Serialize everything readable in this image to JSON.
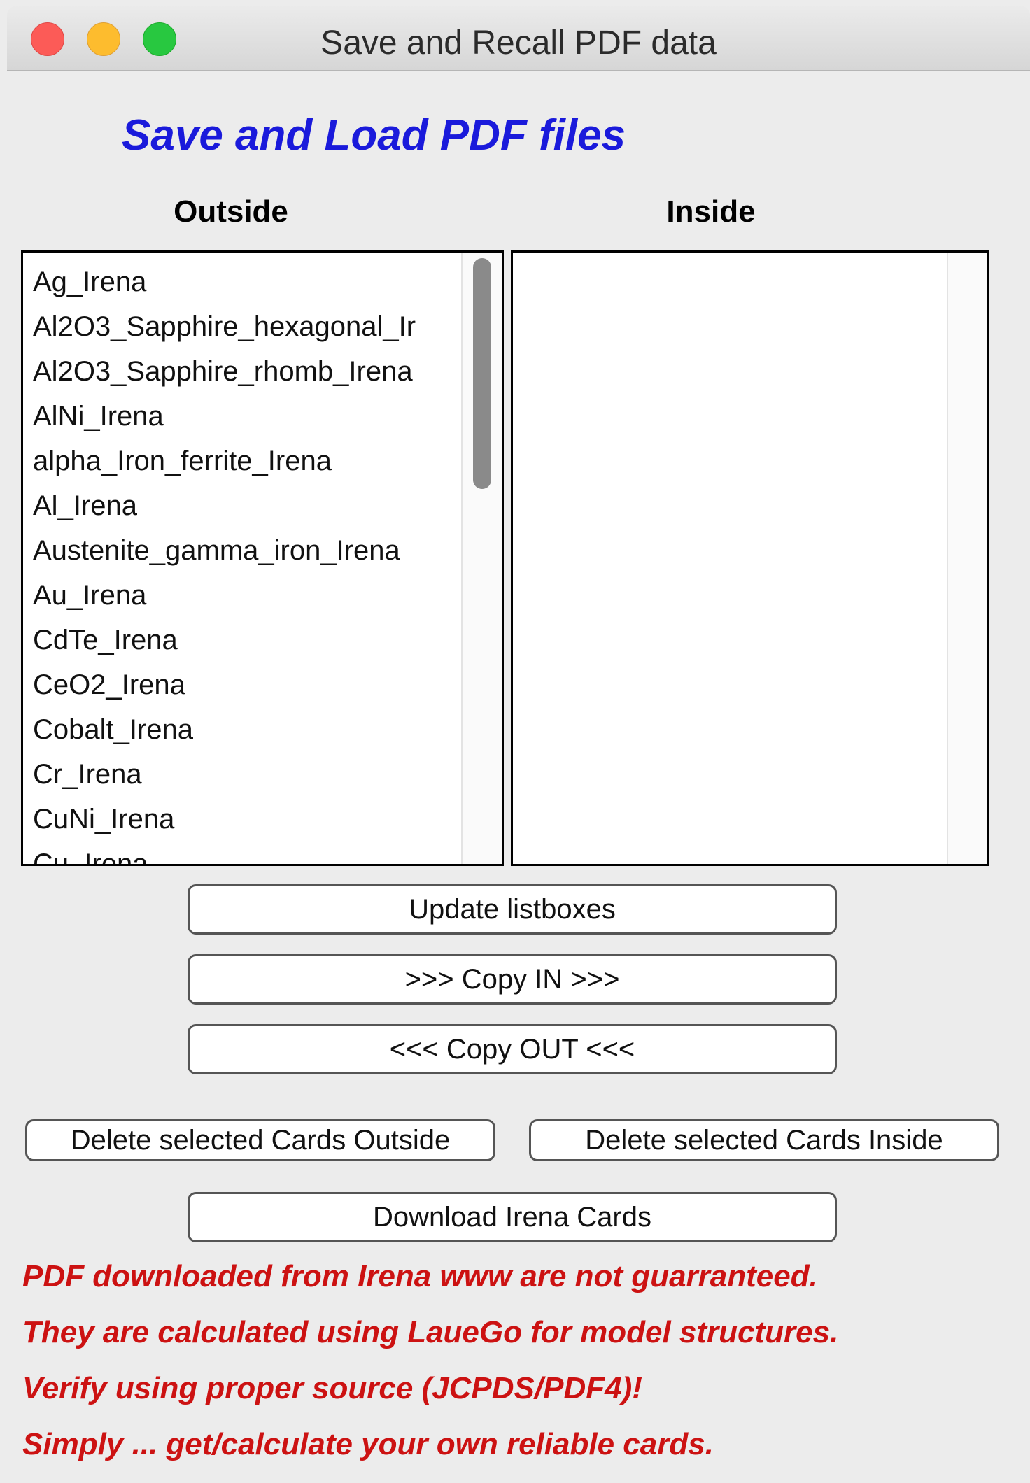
{
  "window": {
    "title": "Save and Recall PDF data"
  },
  "panel": {
    "title": "Save and Load PDF files"
  },
  "columns": {
    "outside_label": "Outside",
    "inside_label": "Inside"
  },
  "outside_list": [
    "Ag_Irena",
    "Al2O3_Sapphire_hexagonal_Ir",
    "Al2O3_Sapphire_rhomb_Irena",
    "AlNi_Irena",
    "alpha_Iron_ferrite_Irena",
    "Al_Irena",
    "Austenite_gamma_iron_Irena",
    "Au_Irena",
    "CdTe_Irena",
    "CeO2_Irena",
    "Cobalt_Irena",
    "Cr_Irena",
    "CuNi_Irena",
    "Cu_Irena"
  ],
  "inside_list": [],
  "buttons": {
    "update": "Update listboxes",
    "copy_in": ">>> Copy IN >>>",
    "copy_out": "<<< Copy OUT <<<",
    "delete_outside": "Delete selected Cards Outside",
    "delete_inside": "Delete selected Cards Inside",
    "download": "Download Irena Cards"
  },
  "warnings": [
    "PDF downloaded from Irena www are not guarranteed.",
    "They are calculated using LaueGo for model structures.",
    "Verify using proper source (JCPDS/PDF4)!",
    "Simply ... get/calculate your own reliable cards."
  ],
  "colors": {
    "title_blue": "#1a1adb",
    "warning_red": "#cc1212"
  }
}
